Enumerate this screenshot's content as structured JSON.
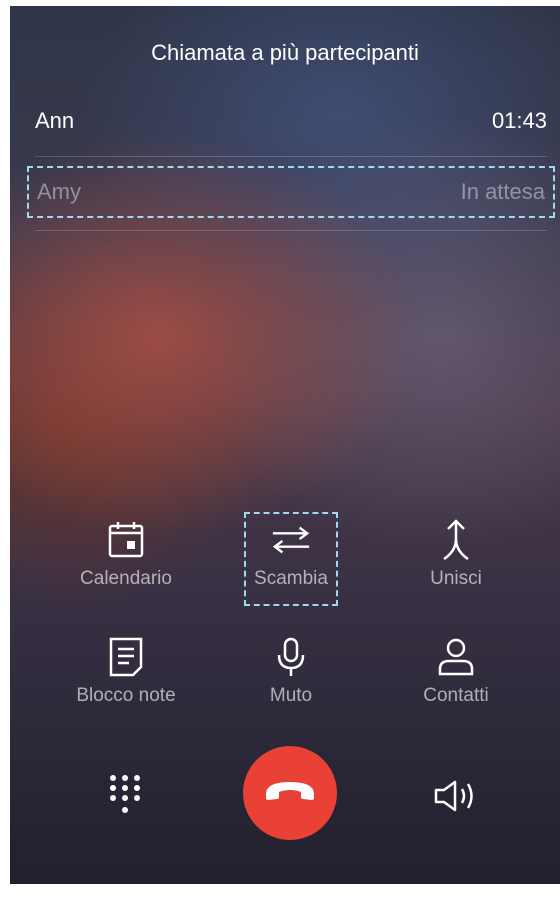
{
  "header": {
    "title": "Chiamata a più partecipanti"
  },
  "calls": [
    {
      "name": "Ann",
      "status": "01:43"
    },
    {
      "name": "Amy",
      "status": "In attesa"
    }
  ],
  "actions": {
    "calendar": {
      "label": "Calendario",
      "icon": "calendar-icon"
    },
    "swap": {
      "label": "Scambia",
      "icon": "swap-arrows-icon"
    },
    "merge": {
      "label": "Unisci",
      "icon": "merge-icon"
    },
    "notepad": {
      "label": "Blocco note",
      "icon": "notepad-icon"
    },
    "mute": {
      "label": "Muto",
      "icon": "microphone-icon"
    },
    "contacts": {
      "label": "Contatti",
      "icon": "contact-icon"
    }
  },
  "bottom_bar": {
    "dialpad_icon": "dialpad-icon",
    "end_call_icon": "end-call-icon",
    "speaker_icon": "speaker-icon"
  },
  "colors": {
    "end_call": "#ea4136",
    "highlight": "#9fd8ef",
    "text_primary": "#ffffff"
  }
}
